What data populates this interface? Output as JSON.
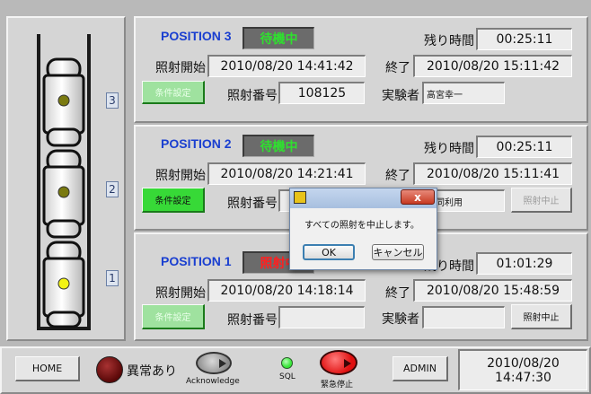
{
  "positions": [
    {
      "label": "POSITION 3",
      "status": "待機中",
      "status_color": "#2fe02f",
      "remain_label": "残り時間",
      "remain": "00:25:11",
      "start_label": "照射開始",
      "start": "2010/08/20 14:41:42",
      "end_label": "終了",
      "end": "2010/08/20 15:11:42",
      "cond_button": "条件設定",
      "number_label": "照射番号",
      "number": "108125",
      "operator_label": "実験者",
      "operator": "高宮幸一"
    },
    {
      "label": "POSITION 2",
      "status": "待機中",
      "status_color": "#2fe02f",
      "remain_label": "残り時間",
      "remain": "00:25:11",
      "start_label": "照射開始",
      "start": "2010/08/20 14:21:41",
      "end_label": "終了",
      "end": "2010/08/20 15:11:41",
      "cond_button": "条件設定",
      "number_label": "照射番号",
      "operator_partial": "共同利用",
      "stop_button": "照射中止"
    },
    {
      "label": "POSITION 1",
      "status": "照射中",
      "status_color": "#ff2020",
      "remain_label": "残り時間",
      "remain": "01:01:29",
      "start_label": "照射開始",
      "start": "2010/08/20 14:18:14",
      "end_label": "終了",
      "end": "2010/08/20 15:48:59",
      "cond_button": "条件設定",
      "number_label": "照射番号",
      "number": "",
      "operator_label": "実験者",
      "operator": "",
      "stop_button": "照射中止"
    }
  ],
  "slots": [
    "3",
    "2",
    "1"
  ],
  "dialog": {
    "message": "すべての照射を中止します。",
    "ok": "OK",
    "cancel": "キャンセル",
    "close": "x"
  },
  "bottom": {
    "home": "HOME",
    "alarm_label": "異常あり",
    "ack_label": "Acknowledge",
    "sql_label": "SQL",
    "estop_label": "緊急停止",
    "admin": "ADMIN",
    "date": "2010/08/20",
    "time": "14:47:30"
  },
  "colors": {
    "position_label": "#1a3fd0",
    "sample_lit": "#f2f214",
    "sample_dim": "#7a7a10",
    "sql_led": "#39e639",
    "estop": "#e01010",
    "alarm": "#5a0808"
  }
}
